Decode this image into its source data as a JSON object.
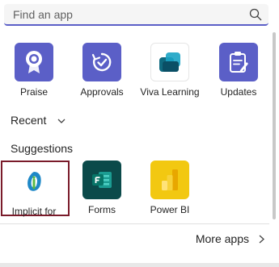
{
  "search": {
    "placeholder": "Find an app",
    "icon": "search-icon"
  },
  "pinned_apps": [
    {
      "label": "Praise",
      "icon": "praise-ribbon-icon",
      "color": "#5b5fc7"
    },
    {
      "label": "Approvals",
      "icon": "approvals-icon",
      "color": "#5b5fc7"
    },
    {
      "label": "Viva Learning",
      "icon": "viva-learning-icon",
      "color": "#ffffff"
    },
    {
      "label": "Updates",
      "icon": "updates-clipboard-icon",
      "color": "#5b5fc7"
    }
  ],
  "recent": {
    "label": "Recent",
    "icon": "chevron-down-icon"
  },
  "suggestions": {
    "label": "Suggestions",
    "apps": [
      {
        "label": "Implicit for",
        "icon": "implicit-icon",
        "color": "#ffffff"
      },
      {
        "label": "Forms",
        "icon": "forms-icon",
        "color": "#0b4a4a"
      },
      {
        "label": "Power BI",
        "icon": "power-bi-icon",
        "color": "#f2c811"
      }
    ]
  },
  "more_apps": {
    "label": "More apps",
    "icon": "chevron-right-icon"
  },
  "colors": {
    "accent": "#5b5fc7",
    "selection": "#7a1b2a"
  }
}
